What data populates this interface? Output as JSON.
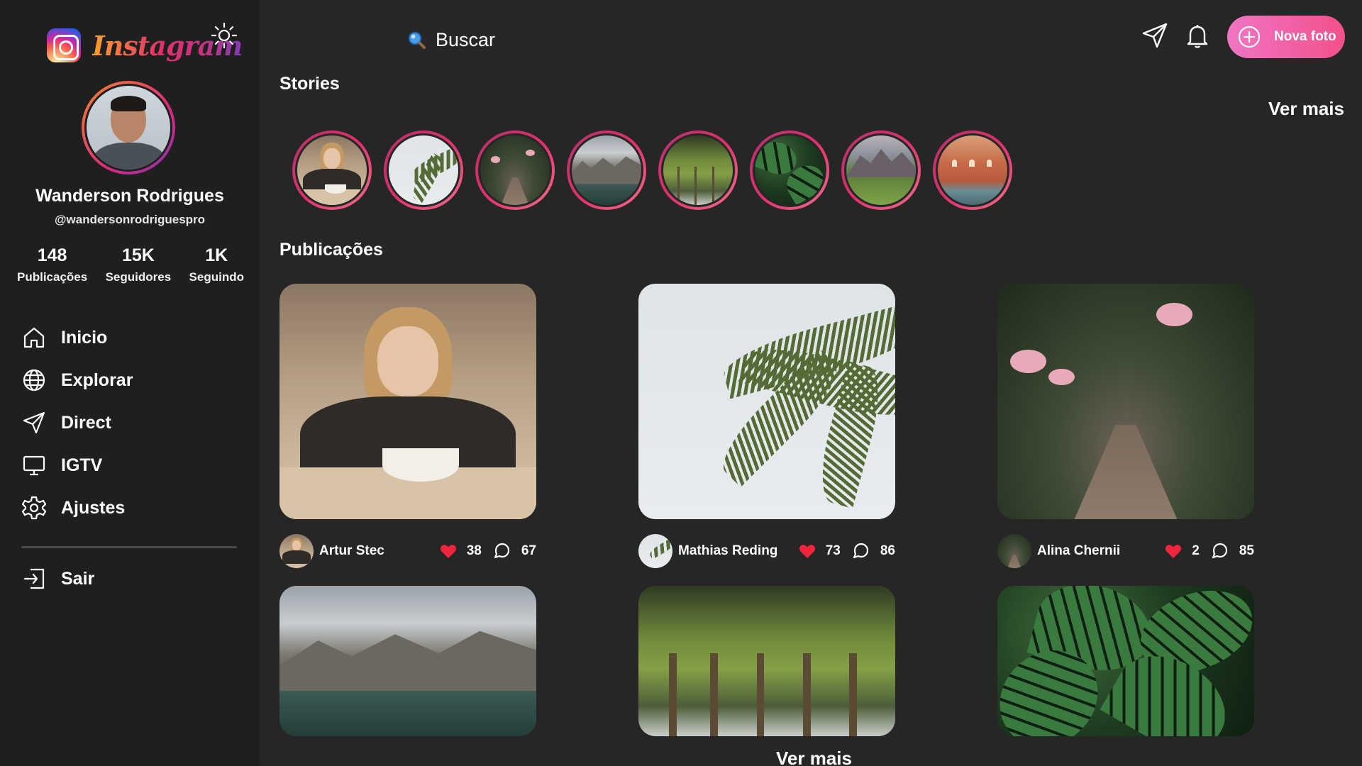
{
  "brand": {
    "name": "Instagram"
  },
  "profile": {
    "name": "Wanderson Rodrigues",
    "handle": "@wandersonrodriguespro",
    "stats": [
      {
        "value": "148",
        "label": "Publicações"
      },
      {
        "value": "15K",
        "label": "Seguidores"
      },
      {
        "value": "1K",
        "label": "Seguindo"
      }
    ]
  },
  "nav": {
    "items": [
      {
        "label": "Inicio",
        "icon": "home-icon"
      },
      {
        "label": "Explorar",
        "icon": "globe-icon"
      },
      {
        "label": "Direct",
        "icon": "send-icon"
      },
      {
        "label": "IGTV",
        "icon": "monitor-icon"
      },
      {
        "label": "Ajustes",
        "icon": "gear-icon"
      }
    ],
    "logout": {
      "label": "Sair",
      "icon": "logout-icon"
    }
  },
  "search": {
    "placeholder": "Buscar",
    "value": ""
  },
  "topbar": {
    "new_photo_label": "Nova foto"
  },
  "stories": {
    "title": "Stories",
    "see_more": "Ver mais",
    "items": [
      "woman-cafe",
      "palm",
      "alley",
      "mountain-lake",
      "palm-trees",
      "monstera",
      "alpine-valley",
      "venice"
    ]
  },
  "posts": {
    "title": "Publicações",
    "see_more": "Ver mais",
    "items": [
      {
        "author": "Artur Stec",
        "likes": "38",
        "comments": "67",
        "photo": "woman-cafe"
      },
      {
        "author": "Mathias Reding",
        "likes": "73",
        "comments": "86",
        "photo": "palm"
      },
      {
        "author": "Alina Chernii",
        "likes": "2",
        "comments": "85",
        "photo": "alley"
      },
      {
        "photo": "mountain-lake"
      },
      {
        "photo": "palm-trees"
      },
      {
        "photo": "monstera"
      }
    ]
  },
  "colors": {
    "background": "#262626",
    "sidebar": "#1f1f1f",
    "accent_gradient": [
      "#f075c4",
      "#f2508a"
    ],
    "like": "#f0243c"
  }
}
